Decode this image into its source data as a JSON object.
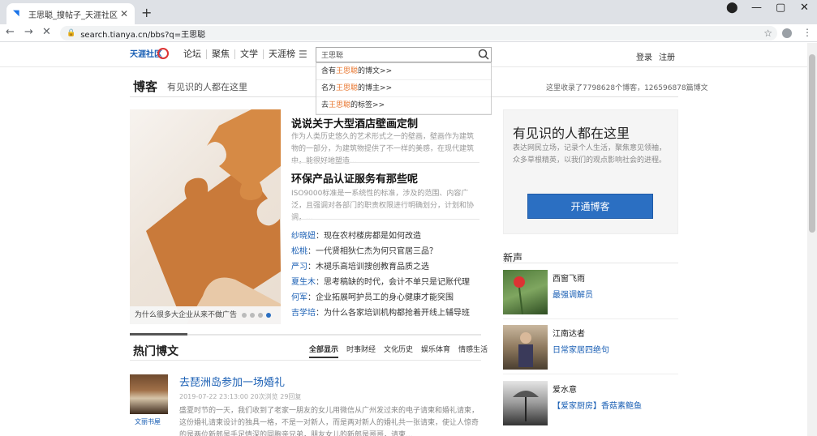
{
  "browser": {
    "tab_title": "王思聪_搜帖子_天涯社区",
    "tab_close": "✕",
    "new_tab": "+",
    "url": "search.tianya.cn/bbs?q=王思聪"
  },
  "site": {
    "logo_text": "天涯社区",
    "nav": [
      "论坛",
      "聚焦",
      "文学",
      "天涯榜"
    ],
    "search_value": "王思聪",
    "login": "登录",
    "register": "注册",
    "suggestions": [
      {
        "pre": "含有",
        "hl": "王思聪",
        "post": "的博文>>"
      },
      {
        "pre": "名为",
        "hl": "王思聪",
        "post": "的博主>>"
      },
      {
        "pre": "去",
        "hl": "王思聪",
        "post": "的标签>>"
      }
    ]
  },
  "blog": {
    "title": "博客",
    "slogan": "有见识的人都在这里",
    "stats": "这里收录了7798628个博客，126596878篇博文",
    "feature_caption": "为什么很多大企业从来不做广告",
    "articles": [
      {
        "title": "说说关于大型酒店壁画定制",
        "text": "作为人类历史悠久的艺术形式之一的壁画，壁画作为建筑物的一部分，为建筑物提供了不一样的美感，在现代建筑中，能很好地塑造..."
      },
      {
        "title": "环保产品认证服务有那些呢",
        "text": "ISO9000标准是一系统性的标准，涉及的范围、内容广泛，且强调对各部门的职责权限进行明确划分，计划和协调，..."
      }
    ],
    "list": [
      {
        "author": "纱晓妞",
        "title": "现在农村楼房都是如何改造"
      },
      {
        "author": "松桃",
        "title": "一代贤相狄仁杰为何只官居三品？"
      },
      {
        "author": "严习",
        "title": "木褪乐高培训搜创教育品质之选"
      },
      {
        "author": "夏生木",
        "title": "思考稿缺的时代，会计不单只是记账代理"
      },
      {
        "author": "何军",
        "title": "企业拓展呵护员工的身心健康才能突围"
      },
      {
        "author": "吉学培",
        "title": "为什么各家培训机构都抢着开线上辅导班"
      }
    ],
    "hot_title": "热门博文",
    "hot_tabs": [
      "全部显示",
      "时事财经",
      "文化历史",
      "娱乐体育",
      "情感生活"
    ],
    "post": {
      "thumb_label": "文丽书屋",
      "title": "去琵洲岛参加一场婚礼",
      "meta": "2019-07-22 23:13:00 20次浏览 29回复",
      "text": "盛夏时节的一天，我们收到了老家一朋友的女儿用微信从广州发过来的电子请柬和婚礼请柬，这份婚礼请柬设计的独具一格，不是一对新人，而是两对新人的婚礼共一张请柬，使让人惊奇的是两位新郎是手足情深的同胞亲兄弟，朋友女儿的新郎是哥哥，请柬..."
    },
    "side": {
      "heading": "有见识的人都在这里",
      "text": "表达网民立场，记录个人生活，聚焦意见领袖，众多草根精英，以我们的观点影响社会的进程。",
      "button": "开通博客",
      "new_heading": "新声",
      "people": [
        {
          "name": "西窗飞雨",
          "blog": "最强调解员"
        },
        {
          "name": "江南达者",
          "blog": "日常家居四绝句"
        },
        {
          "name": "爱水意",
          "blog": "【爱家厨房】香菇素鲍鱼"
        }
      ]
    }
  },
  "colors": {
    "accent": "#2b6fc2",
    "link": "#1a5fb4",
    "highlight": "#e8742b",
    "puzzle": "#c97a3a"
  }
}
